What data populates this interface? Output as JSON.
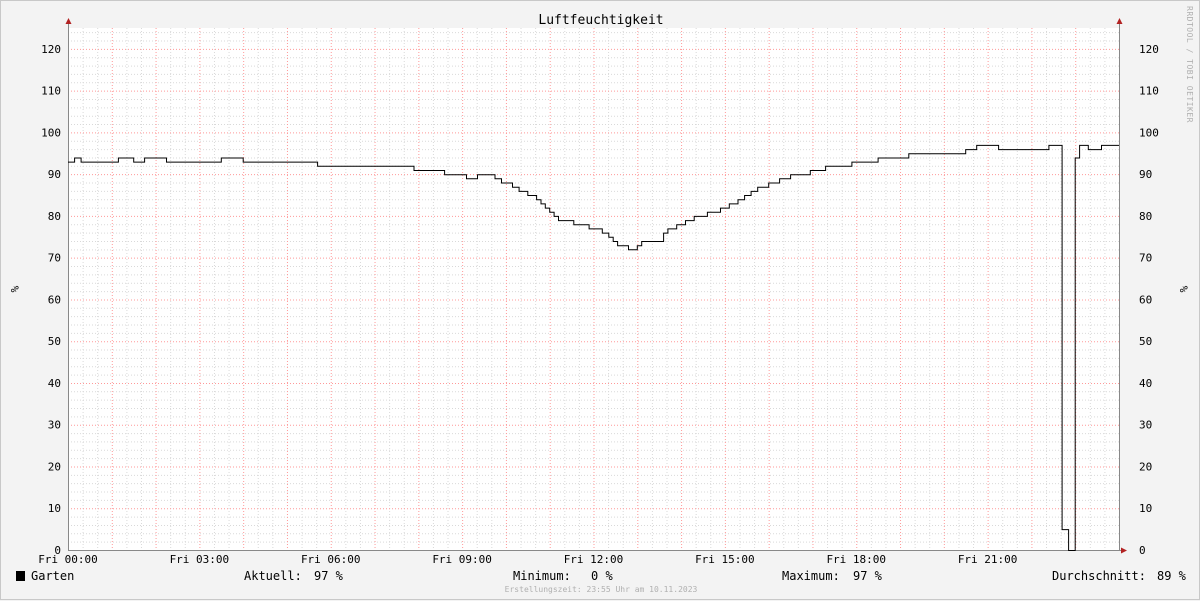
{
  "chart_data": {
    "type": "line",
    "title": "Luftfeuchtigkeit",
    "ylabel": "%",
    "ylim": [
      0,
      125
    ],
    "xlim": [
      0,
      24
    ],
    "yticks": [
      0,
      10,
      20,
      30,
      40,
      50,
      60,
      70,
      80,
      90,
      100,
      110,
      120
    ],
    "xticks": [
      {
        "hour": 0,
        "label": "Fri 00:00"
      },
      {
        "hour": 3,
        "label": "Fri 03:00"
      },
      {
        "hour": 6,
        "label": "Fri 06:00"
      },
      {
        "hour": 9,
        "label": "Fri 09:00"
      },
      {
        "hour": 12,
        "label": "Fri 12:00"
      },
      {
        "hour": 15,
        "label": "Fri 15:00"
      },
      {
        "hour": 18,
        "label": "Fri 18:00"
      },
      {
        "hour": 21,
        "label": "Fri 21:00"
      }
    ],
    "series": [
      {
        "name": "Garten",
        "color": "#000000",
        "points": [
          [
            0.0,
            93
          ],
          [
            0.15,
            94
          ],
          [
            0.3,
            93
          ],
          [
            1.15,
            94
          ],
          [
            1.5,
            93
          ],
          [
            1.75,
            94
          ],
          [
            2.25,
            93
          ],
          [
            3.5,
            94
          ],
          [
            4.0,
            93
          ],
          [
            5.7,
            92
          ],
          [
            7.9,
            91
          ],
          [
            8.6,
            90
          ],
          [
            9.1,
            89
          ],
          [
            9.35,
            90
          ],
          [
            9.75,
            89
          ],
          [
            9.9,
            88
          ],
          [
            10.15,
            87
          ],
          [
            10.3,
            86
          ],
          [
            10.5,
            85
          ],
          [
            10.7,
            84
          ],
          [
            10.8,
            83
          ],
          [
            10.9,
            82
          ],
          [
            11.0,
            81
          ],
          [
            11.1,
            80
          ],
          [
            11.2,
            79
          ],
          [
            11.55,
            78
          ],
          [
            11.9,
            77
          ],
          [
            12.2,
            76
          ],
          [
            12.35,
            75
          ],
          [
            12.45,
            74
          ],
          [
            12.55,
            73
          ],
          [
            12.8,
            72
          ],
          [
            13.0,
            73
          ],
          [
            13.1,
            74
          ],
          [
            13.6,
            76
          ],
          [
            13.7,
            77
          ],
          [
            13.9,
            78
          ],
          [
            14.1,
            79
          ],
          [
            14.3,
            80
          ],
          [
            14.6,
            81
          ],
          [
            14.9,
            82
          ],
          [
            15.1,
            83
          ],
          [
            15.3,
            84
          ],
          [
            15.45,
            85
          ],
          [
            15.6,
            86
          ],
          [
            15.75,
            87
          ],
          [
            16.0,
            88
          ],
          [
            16.25,
            89
          ],
          [
            16.5,
            90
          ],
          [
            16.95,
            91
          ],
          [
            17.3,
            92
          ],
          [
            17.9,
            93
          ],
          [
            18.5,
            94
          ],
          [
            19.2,
            95
          ],
          [
            20.5,
            96
          ],
          [
            20.75,
            97
          ],
          [
            21.25,
            96
          ],
          [
            22.4,
            97
          ],
          [
            22.7,
            5
          ],
          [
            22.85,
            0
          ],
          [
            23.0,
            94
          ],
          [
            23.1,
            97
          ],
          [
            23.3,
            96
          ],
          [
            23.5,
            96
          ],
          [
            23.6,
            97
          ],
          [
            24.0,
            97
          ]
        ]
      }
    ],
    "legend": "bottom-left",
    "grid": true
  },
  "legend": {
    "series_name": "Garten",
    "current_label": "Aktuell:",
    "current_value": "97 %",
    "min_label": "Minimum:",
    "min_value": "0 %",
    "max_label": "Maximum:",
    "max_value": "97 %",
    "avg_label": "Durchschnitt:",
    "avg_value": "89 %"
  },
  "footer": "Erstellungszeit: 23:55 Uhr am 10.11.2023",
  "watermark": "RRDTOOL / TOBI OETIKER",
  "colors": {
    "background": "#f3f3f3",
    "plot_background": "#ffffff",
    "minor_grid": "#d9d9d9",
    "major_grid": "#ff9999",
    "axis": "#888888",
    "arrow": "#b22222",
    "line": "#000000"
  }
}
